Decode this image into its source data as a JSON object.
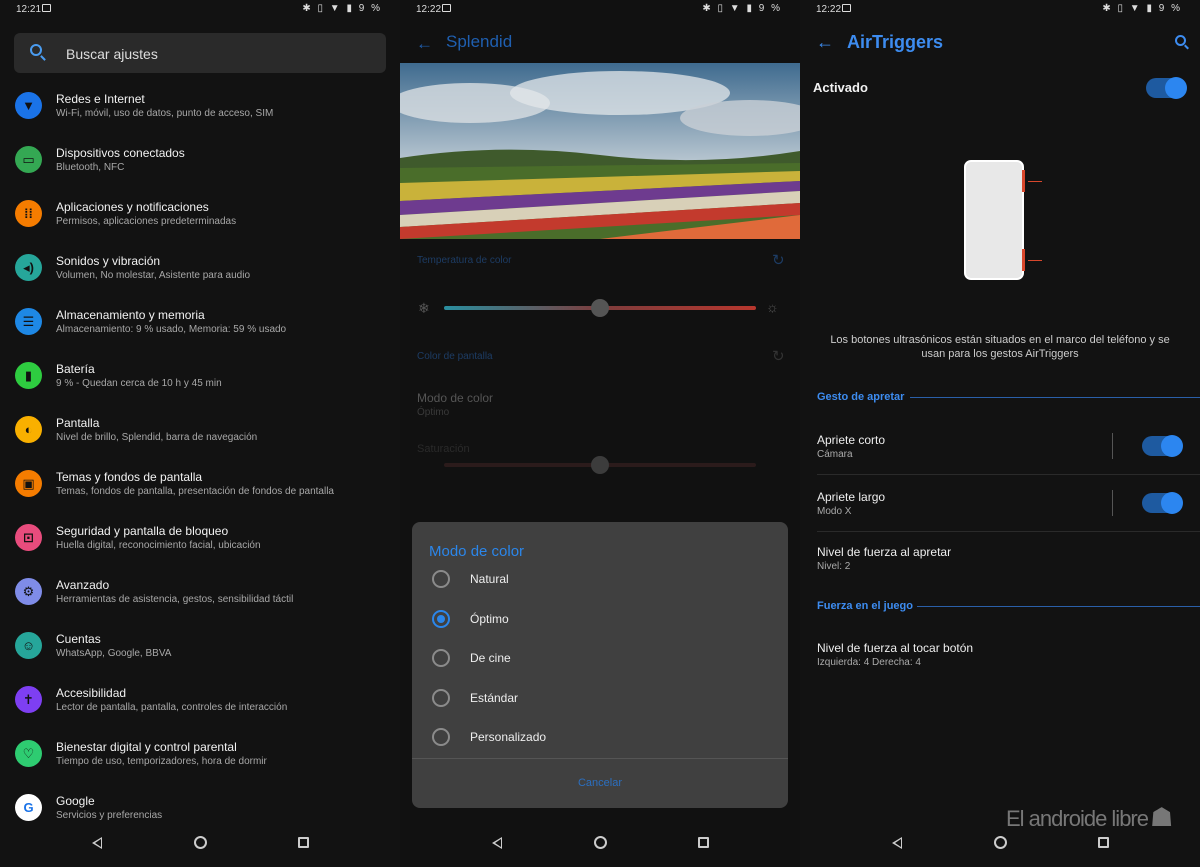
{
  "screen1": {
    "status": {
      "time": "12:21",
      "battery": "9 %"
    },
    "search": {
      "placeholder": "Buscar ajustes",
      "icon": "search-icon"
    },
    "items": [
      {
        "title": "Redes e Internet",
        "subtitle": "Wi-Fi, móvil, uso de datos, punto de acceso, SIM",
        "icon": "wifi-icon",
        "color": "#1a73e8"
      },
      {
        "title": "Dispositivos conectados",
        "subtitle": "Bluetooth, NFC",
        "icon": "devices-icon",
        "color": "#34a853"
      },
      {
        "title": "Aplicaciones y notificaciones",
        "subtitle": "Permisos, aplicaciones predeterminadas",
        "icon": "apps-icon",
        "color": "#f57c00"
      },
      {
        "title": "Sonidos y vibración",
        "subtitle": "Volumen, No molestar, Asistente para audio",
        "icon": "volume-icon",
        "color": "#26a69a"
      },
      {
        "title": "Almacenamiento y memoria",
        "subtitle": "Almacenamiento: 9 % usado, Memoria: 59 % usado",
        "icon": "storage-icon",
        "color": "#1e88e5"
      },
      {
        "title": "Batería",
        "subtitle": "9 % - Quedan cerca de 10 h y 45 min",
        "icon": "battery-icon",
        "color": "#2ecc40"
      },
      {
        "title": "Pantalla",
        "subtitle": "Nivel de brillo, Splendid, barra de navegación",
        "icon": "display-icon",
        "color": "#f9b000"
      },
      {
        "title": "Temas y fondos de pantalla",
        "subtitle": "Temas, fondos de pantalla, presentación de fondos de pantalla",
        "icon": "wallpaper-icon",
        "color": "#f57c00"
      },
      {
        "title": "Seguridad y pantalla de bloqueo",
        "subtitle": "Huella digital, reconocimiento facial, ubicación",
        "icon": "lock-icon",
        "color": "#e84c7d"
      },
      {
        "title": "Avanzado",
        "subtitle": "Herramientas de asistencia, gestos, sensibilidad táctil",
        "icon": "gear-icon",
        "color": "#7f8ce8"
      },
      {
        "title": "Cuentas",
        "subtitle": "WhatsApp, Google, BBVA",
        "icon": "account-icon",
        "color": "#26a69a"
      },
      {
        "title": "Accesibilidad",
        "subtitle": "Lector de pantalla, pantalla, controles de interacción",
        "icon": "accessibility-icon",
        "color": "#7e3ff2"
      },
      {
        "title": "Bienestar digital y control parental",
        "subtitle": "Tiempo de uso, temporizadores, hora de dormir",
        "icon": "wellbeing-icon",
        "color": "#2ecc71"
      },
      {
        "title": "Google",
        "subtitle": "Servicios y preferencias",
        "icon": "google-icon",
        "color": "#1a73e8"
      }
    ]
  },
  "screen2": {
    "status": {
      "time": "12:22",
      "battery": "9 %"
    },
    "title": "Splendid",
    "temp_label": "Temperatura de color",
    "temp_level": 0.5,
    "screen_color_label": "Color de pantalla",
    "color_mode_title": "Modo de color",
    "color_mode_value": "Óptimo",
    "saturation_label": "Saturación",
    "saturation_level": 0.5,
    "dialog": {
      "title": "Modo de color",
      "options": [
        "Natural",
        "Óptimo",
        "De cine",
        "Estándar",
        "Personalizado"
      ],
      "selected": "Óptimo",
      "cancel": "Cancelar"
    }
  },
  "screen3": {
    "status": {
      "time": "12:22",
      "battery": "9 %"
    },
    "title": "AirTriggers",
    "enabled_label": "Activado",
    "description": "Los botones ultrasónicos están situados en el marco del teléfono y se usan para los gestos AirTriggers",
    "section1": "Gesto de apretar",
    "short_press": {
      "title": "Apriete corto",
      "value": "Cámara"
    },
    "long_press": {
      "title": "Apriete largo",
      "value": "Modo X"
    },
    "force_level": {
      "title": "Nivel de fuerza al apretar",
      "value": "Nivel: 2"
    },
    "section2": "Fuerza en el juego",
    "touch_force": {
      "title": "Nivel de fuerza al tocar botón",
      "value": "Izquierda: 4 Derecha: 4"
    },
    "watermark": "El androide libre"
  }
}
